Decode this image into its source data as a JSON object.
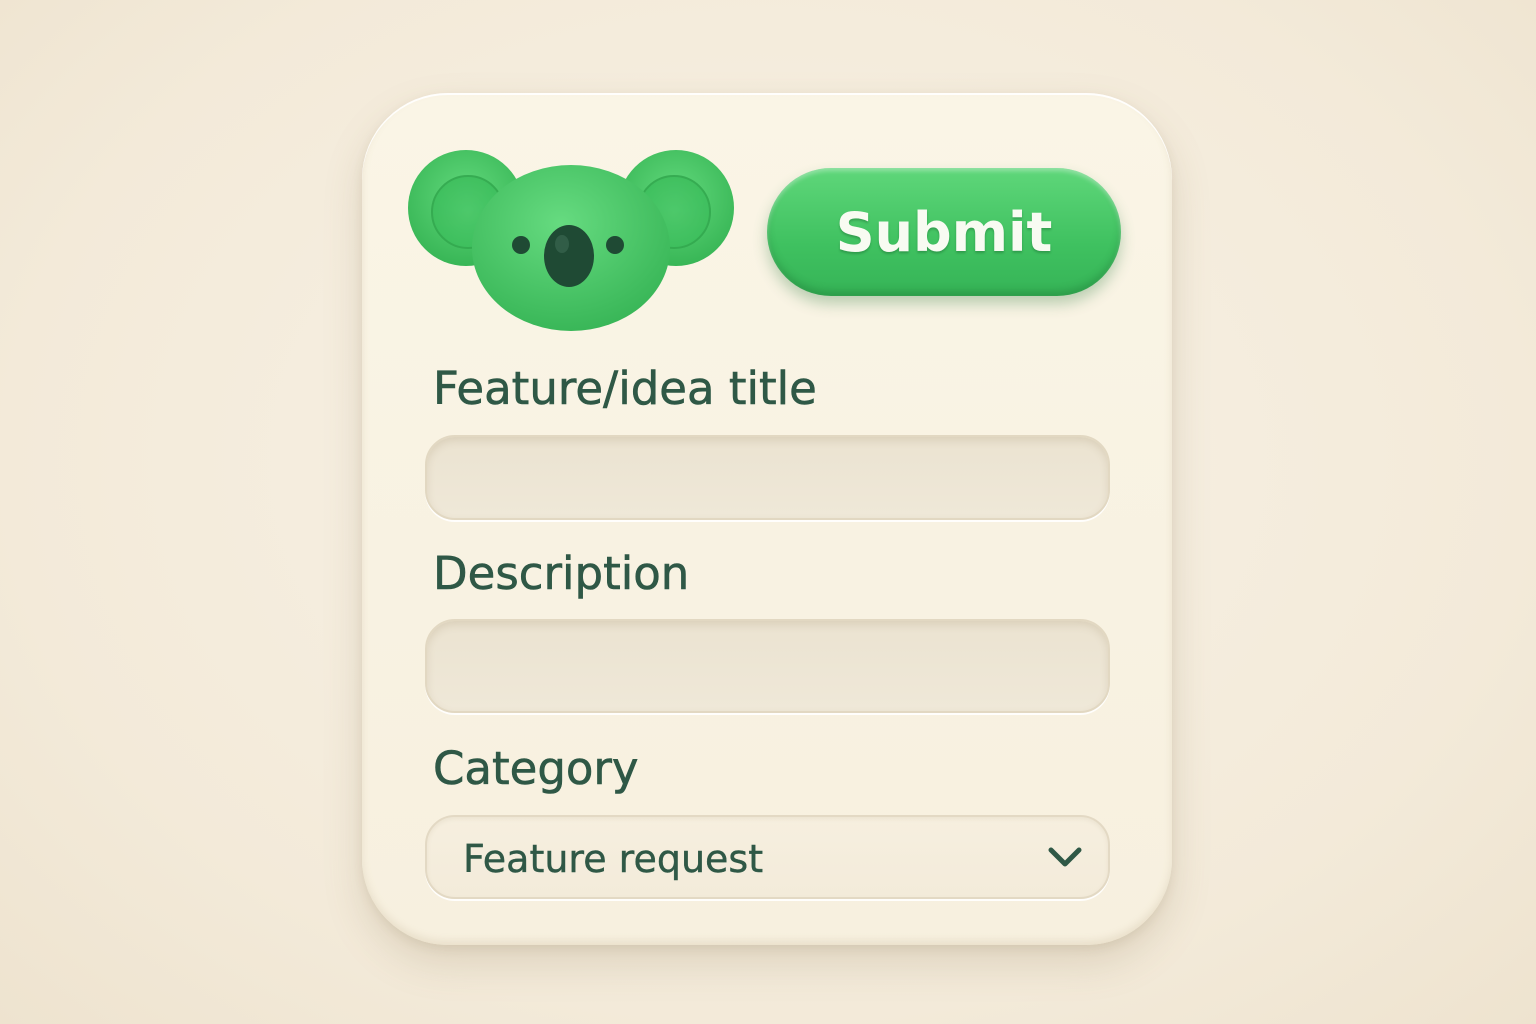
{
  "header": {
    "logo_icon": "koala-icon",
    "submit_label": "Submit"
  },
  "form": {
    "title_field": {
      "label": "Feature/idea title",
      "value": "",
      "placeholder": ""
    },
    "description_field": {
      "label": "Description",
      "value": "",
      "placeholder": ""
    },
    "category_field": {
      "label": "Category",
      "selected": "Feature request",
      "icon": "chevron-down-icon"
    }
  },
  "colors": {
    "background": "#f6eedf",
    "card": "#f8f2e2",
    "accent_green": "#3fc160",
    "text_dark_green": "#2f5846",
    "koala_nose": "#1f4a34"
  }
}
